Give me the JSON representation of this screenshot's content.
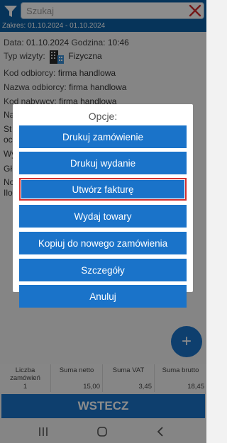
{
  "header": {
    "search_placeholder": "Szukaj",
    "range_label": "Zakres:",
    "range_from": "01.10.2024",
    "range_sep": "-",
    "range_to": "01.10.2024",
    "accent": "#0b5fa4"
  },
  "details": {
    "date_label": "Data:",
    "date_value": "01.10.2024",
    "time_label": "Godzina:",
    "time_value": "10:46",
    "visit_type_label": "Typ wizyty:",
    "visit_type_value": "Fizyczna",
    "visit_type_icon": "building-icon",
    "recipient_code_label": "Kod odbiorcy:",
    "recipient_code_value": "firma handlowa",
    "recipient_name_label": "Nazwa odbiorcy:",
    "recipient_name_value": "firma handlowa",
    "buyer_code_label": "Kod nabywcy:",
    "buyer_code_value": "firma handlowa",
    "hidden_rows": [
      "Na",
      "St",
      "oc",
      "Wy",
      "Gł",
      "No",
      "Ilo"
    ]
  },
  "dialog": {
    "title": "Opcje:",
    "options": [
      {
        "label": "Drukuj zamówienie"
      },
      {
        "label": "Drukuj wydanie"
      },
      {
        "label": "Utwórz fakturę",
        "selected": true
      },
      {
        "label": "Wydaj towary"
      },
      {
        "label": "Kopiuj do nowego zamówienia"
      },
      {
        "label": "Szczegóły"
      },
      {
        "label": "Anuluj"
      }
    ],
    "button_color": "#1a73c9",
    "selected_border": "#d32f2f"
  },
  "fab": {
    "label": "+"
  },
  "summary": {
    "headers": [
      "Liczba zamówień",
      "Suma netto",
      "Suma VAT",
      "Suma brutto"
    ],
    "values": [
      "1",
      "15,00",
      "3,45",
      "18,45"
    ]
  },
  "footer": {
    "back_label": "WSTECZ"
  },
  "navbar": {
    "icons": [
      "recent-apps-icon",
      "home-icon",
      "back-icon"
    ]
  }
}
